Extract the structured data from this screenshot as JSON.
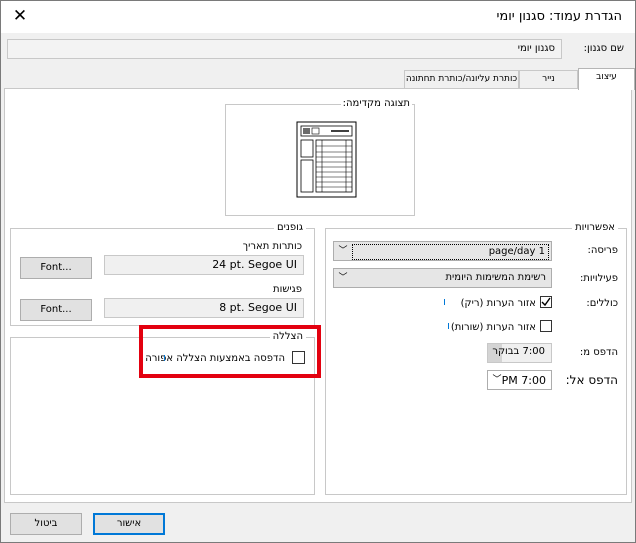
{
  "window": {
    "title": "הגדרת עמוד: סגנון יומי"
  },
  "style_name": {
    "label": "שם סגנון:",
    "value": "סגנון יומי"
  },
  "tabs": [
    {
      "label": "עיצוב",
      "active": true
    },
    {
      "label": "נייר",
      "active": false
    },
    {
      "label": "כותרת עליונה/כותרת תחתונה",
      "active": false
    }
  ],
  "preview": {
    "label": "תצוגה מקדימה:"
  },
  "options": {
    "title": "אפשרויות",
    "layout_label": "פריסה:",
    "layout_value": "1 page/day",
    "tasks_label": "פעילויות:",
    "tasks_value": "רשימת המשימות היומית",
    "include_label": "כוללים:",
    "notes_blank_label": "אזור הערות (ריק)",
    "notes_lined_label": "אזור הערות (שורות)",
    "print_from_label": "הדפס מ:",
    "print_from_value": "7:00 בבוקר",
    "print_to_label": "הדפס אל:",
    "print_to_value": "7:00 PM"
  },
  "fonts": {
    "title": "גופנים",
    "date_headings_label": "כותרות תאריך",
    "date_headings_value": "24 pt. Segoe UI",
    "appointments_label": "פגישות",
    "appointments_value": "8 pt. Segoe UI",
    "font_button_label": "Font..."
  },
  "shading": {
    "title": "הצללה",
    "gray_shading_label": "הדפסה באמצעות הצללה אפורה"
  },
  "footer": {
    "ok_label": "אישור",
    "cancel_label": "ביטול"
  },
  "colors": {
    "accent": "#0078d7",
    "highlight": "#e3000f"
  },
  "icons": {
    "close": "close-icon",
    "dropdown": "chevron-down-icon"
  }
}
